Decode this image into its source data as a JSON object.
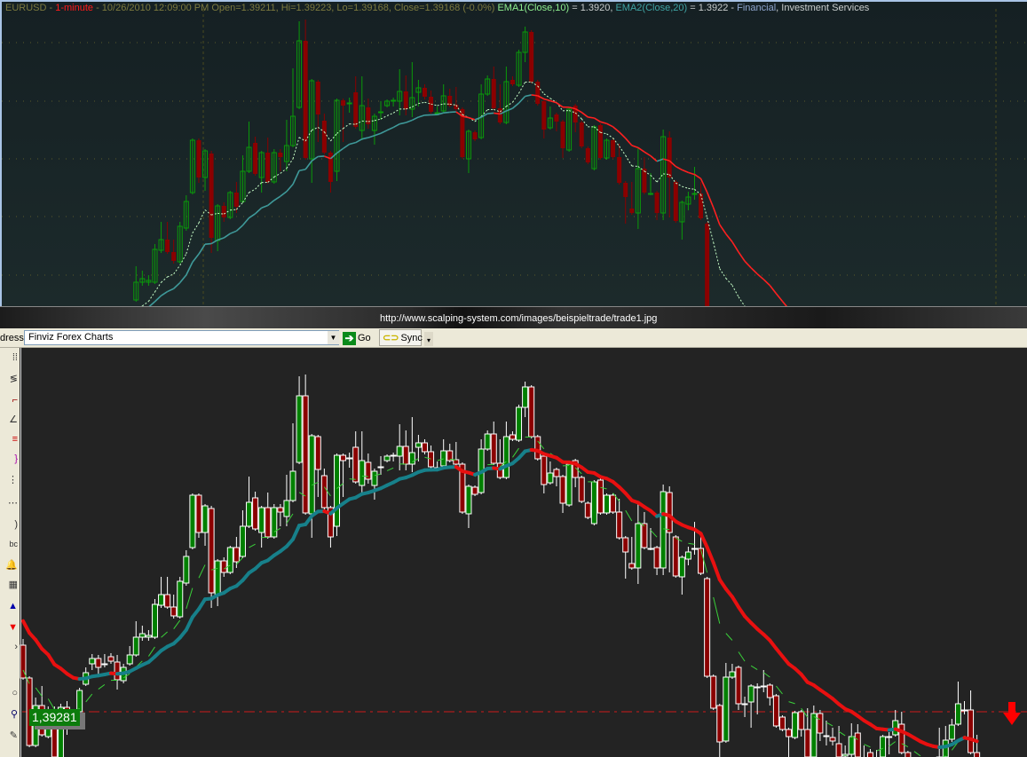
{
  "top_chart": {
    "symbol": "EURUSD",
    "sep1": " - ",
    "interval": "1-minute",
    "readout": " - 10/26/2010 12:09:00 PM Open=1.39211, Hi=1.39223, Lo=1.39168, Close=1.39168 (-0.0%) ",
    "ema1_label": "EMA1(Close,10)",
    "ema1_value": " = 1.3920, ",
    "ema2_label": "EMA2(Close,20)",
    "ema2_value": " = 1.3922 - ",
    "category_a": "Financial",
    "category_b": ", Investment Services"
  },
  "browser": {
    "url": "http://www.scalping-system.com/images/beispieltrade/trade1.jpg",
    "address_label": "dress",
    "address_value": "Finviz Forex Charts",
    "dropdown_icon": "▼",
    "go_label": "Go",
    "sync_label": "Sync",
    "more_icon": "▾"
  },
  "toolbar_icons": [
    "grid-dots",
    "trend-lines",
    "line-tool",
    "fan-tool",
    "color-lines",
    "bracket-tool",
    "vertical-dots",
    "horizontal-dots",
    "signal-tool",
    "text-abc",
    "bell-alert",
    "calculator",
    "buy-arrow",
    "sell-arrow",
    "pointer-tool",
    "circle-tool",
    "zoom-magnifier",
    "pencil-tool"
  ],
  "price_line": {
    "label": "1,39281",
    "value": 1.39281
  },
  "colors": {
    "up": "#008000",
    "down": "#8b0000",
    "ema_rise": "#17808a",
    "ema_fall": "#e81010",
    "ema10": "#3ad03a",
    "price_line": "#cc1a1a",
    "arrow": "#ff0000"
  },
  "chart_data": {
    "type": "candlestick",
    "title": "EURUSD - 1-minute",
    "xlabel": "",
    "ylabel": "",
    "indicators": [
      {
        "name": "EMA1(Close,10)",
        "period": 10,
        "seed": 1.3933
      },
      {
        "name": "EMA2(Close,20)",
        "period": 20,
        "seed": 1.3939
      }
    ],
    "ohlc_fields": [
      "open",
      "high",
      "low",
      "close"
    ],
    "candles": [
      [
        1.39356,
        1.39363,
        1.39317,
        1.39319
      ],
      [
        1.39319,
        1.39321,
        1.39241,
        1.39243
      ],
      [
        1.39243,
        1.39297,
        1.39241,
        1.39288
      ],
      [
        1.39288,
        1.3931,
        1.39253,
        1.39255
      ],
      [
        1.39253,
        1.39287,
        1.39251,
        1.39283
      ],
      [
        1.39283,
        1.39287,
        1.39221,
        1.3923
      ],
      [
        1.39223,
        1.3929,
        1.39221,
        1.39286
      ],
      [
        1.39286,
        1.39293,
        1.39255,
        1.39268
      ],
      [
        1.39278,
        1.39283,
        1.39271,
        1.39276
      ],
      [
        1.39281,
        1.39308,
        1.39278,
        1.39305
      ],
      [
        1.39312,
        1.39331,
        1.3931,
        1.39325
      ],
      [
        1.39335,
        1.39346,
        1.39328,
        1.39341
      ],
      [
        1.39341,
        1.39345,
        1.39323,
        1.39331
      ],
      [
        1.39335,
        1.39346,
        1.39331,
        1.39335
      ],
      [
        1.39343,
        1.39347,
        1.39335,
        1.39338
      ],
      [
        1.39337,
        1.39345,
        1.39306,
        1.39317
      ],
      [
        1.39316,
        1.39335,
        1.39313,
        1.39331
      ],
      [
        1.39335,
        1.39355,
        1.39333,
        1.39345
      ],
      [
        1.39345,
        1.39383,
        1.39343,
        1.39365
      ],
      [
        1.39365,
        1.39378,
        1.39361,
        1.39369
      ],
      [
        1.39365,
        1.39373,
        1.39361,
        1.39367
      ],
      [
        1.39365,
        1.39408,
        1.39363,
        1.39402
      ],
      [
        1.39401,
        1.39433,
        1.39398,
        1.39413
      ],
      [
        1.39413,
        1.39433,
        1.39397,
        1.39399
      ],
      [
        1.39399,
        1.39413,
        1.39386,
        1.39389
      ],
      [
        1.39388,
        1.39433,
        1.39386,
        1.39428
      ],
      [
        1.39426,
        1.39463,
        1.39423,
        1.39456
      ],
      [
        1.39466,
        1.39527,
        1.39464,
        1.39525
      ],
      [
        1.39525,
        1.39527,
        1.39477,
        1.39483
      ],
      [
        1.39483,
        1.39515,
        1.39468,
        1.39513
      ],
      [
        1.3951,
        1.39513,
        1.39398,
        1.39415
      ],
      [
        1.39412,
        1.39453,
        1.394,
        1.39451
      ],
      [
        1.39451,
        1.39455,
        1.39433,
        1.39438
      ],
      [
        1.39438,
        1.39468,
        1.39436,
        1.39466
      ],
      [
        1.39466,
        1.39478,
        1.39443,
        1.3945
      ],
      [
        1.39456,
        1.39508,
        1.39454,
        1.3949
      ],
      [
        1.3949,
        1.39546,
        1.39488,
        1.39517
      ],
      [
        1.39522,
        1.39529,
        1.39485,
        1.39487
      ],
      [
        1.39483,
        1.39513,
        1.39466,
        1.39511
      ],
      [
        1.39511,
        1.39528,
        1.39476,
        1.39478
      ],
      [
        1.39478,
        1.39515,
        1.39476,
        1.39511
      ],
      [
        1.39511,
        1.39515,
        1.3949,
        1.39506
      ],
      [
        1.39501,
        1.39548,
        1.3949,
        1.39519
      ],
      [
        1.39519,
        1.39606,
        1.39517,
        1.39552
      ],
      [
        1.39562,
        1.39659,
        1.3956,
        1.39637
      ],
      [
        1.39637,
        1.39661,
        1.39503,
        1.39505
      ],
      [
        1.39504,
        1.39594,
        1.39477,
        1.39592
      ],
      [
        1.39591,
        1.39593,
        1.39523,
        1.39554
      ],
      [
        1.39547,
        1.39555,
        1.39509,
        1.39511
      ],
      [
        1.39511,
        1.39513,
        1.39466,
        1.39478
      ],
      [
        1.3949,
        1.39572,
        1.39479,
        1.3957
      ],
      [
        1.3957,
        1.39572,
        1.39523,
        1.39564
      ],
      [
        1.39567,
        1.39573,
        1.39556,
        1.39567
      ],
      [
        1.39579,
        1.39597,
        1.39538,
        1.3954
      ],
      [
        1.39536,
        1.39597,
        1.39525,
        1.39564
      ],
      [
        1.39562,
        1.39572,
        1.39538,
        1.39543
      ],
      [
        1.39536,
        1.39555,
        1.3952,
        1.39552
      ],
      [
        1.39557,
        1.39569,
        1.39548,
        1.39557
      ],
      [
        1.39564,
        1.39571,
        1.39562,
        1.39569
      ],
      [
        1.3957,
        1.39573,
        1.39563,
        1.3957
      ],
      [
        1.39569,
        1.39605,
        1.39553,
        1.3958
      ],
      [
        1.3958,
        1.39598,
        1.39553,
        1.3956
      ],
      [
        1.3956,
        1.39613,
        1.39551,
        1.39573
      ],
      [
        1.39579,
        1.39593,
        1.39563,
        1.39584
      ],
      [
        1.39584,
        1.39588,
        1.39571,
        1.39574
      ],
      [
        1.39574,
        1.39581,
        1.39555,
        1.39557
      ],
      [
        1.39556,
        1.39563,
        1.39553,
        1.39556
      ],
      [
        1.39558,
        1.39588,
        1.39556,
        1.39575
      ],
      [
        1.39575,
        1.39583,
        1.39562,
        1.39564
      ],
      [
        1.39565,
        1.39585,
        1.39558,
        1.3956
      ],
      [
        1.3956,
        1.39562,
        1.39504,
        1.39506
      ],
      [
        1.39504,
        1.39537,
        1.39488,
        1.39535
      ],
      [
        1.39534,
        1.39536,
        1.39524,
        1.39526
      ],
      [
        1.39528,
        1.39588,
        1.39526,
        1.39577
      ],
      [
        1.39577,
        1.39598,
        1.39575,
        1.39594
      ],
      [
        1.39594,
        1.39608,
        1.39559,
        1.39561
      ],
      [
        1.39561,
        1.39588,
        1.39543,
        1.39545
      ],
      [
        1.39545,
        1.39608,
        1.39543,
        1.39591
      ],
      [
        1.39593,
        1.39597,
        1.39586,
        1.39588
      ],
      [
        1.39587,
        1.39627,
        1.39585,
        1.39624
      ],
      [
        1.39624,
        1.39653,
        1.39613,
        1.39647
      ],
      [
        1.39647,
        1.39649,
        1.39589,
        1.39591
      ],
      [
        1.39591,
        1.39593,
        1.39564,
        1.39566
      ],
      [
        1.39569,
        1.39571,
        1.39527,
        1.39537
      ],
      [
        1.39539,
        1.39563,
        1.39537,
        1.3955
      ],
      [
        1.39554,
        1.39556,
        1.39535,
        1.39546
      ],
      [
        1.39546,
        1.39548,
        1.39505,
        1.39516
      ],
      [
        1.39514,
        1.39562,
        1.39512,
        1.3956
      ],
      [
        1.39564,
        1.39566,
        1.39534,
        1.39545
      ],
      [
        1.39545,
        1.39547,
        1.39516,
        1.39518
      ],
      [
        1.39516,
        1.39518,
        1.39498,
        1.395
      ],
      [
        1.39493,
        1.39542,
        1.39491,
        1.3954
      ],
      [
        1.39542,
        1.39544,
        1.39503,
        1.39505
      ],
      [
        1.39505,
        1.39527,
        1.39503,
        1.39525
      ],
      [
        1.39525,
        1.39527,
        1.39504,
        1.39506
      ],
      [
        1.39506,
        1.39521,
        1.39475,
        1.39477
      ],
      [
        1.39477,
        1.39479,
        1.39431,
        1.39461
      ],
      [
        1.39448,
        1.39478,
        1.39441,
        1.39443
      ],
      [
        1.39443,
        1.39516,
        1.39425,
        1.39493
      ],
      [
        1.39493,
        1.39506,
        1.39464,
        1.39466
      ],
      [
        1.39465,
        1.39488,
        1.39463,
        1.39465
      ],
      [
        1.39466,
        1.39468,
        1.39435,
        1.39443
      ],
      [
        1.39443,
        1.39537,
        1.39435,
        1.39529
      ],
      [
        1.39528,
        1.39535,
        1.39438,
        1.39483
      ],
      [
        1.39478,
        1.3948,
        1.39432,
        1.39434
      ],
      [
        1.39433,
        1.39457,
        1.39413,
        1.39455
      ],
      [
        1.39453,
        1.39467,
        1.39446,
        1.39461
      ],
      [
        1.39465,
        1.39495,
        1.39458,
        1.39465
      ],
      [
        1.39465,
        1.39478,
        1.39435,
        1.39437
      ],
      [
        1.39431,
        1.39433,
        1.39319,
        1.39321
      ],
      [
        1.39321,
        1.39323,
        1.39283,
        1.39285
      ],
      [
        1.39288,
        1.3929,
        1.3923,
        1.39247
      ],
      [
        1.39248,
        1.39336,
        1.39246,
        1.3932
      ],
      [
        1.3932,
        1.39335,
        1.39318,
        1.39326
      ],
      [
        1.39331,
        1.39333,
        1.39283,
        1.3929
      ],
      [
        1.3929,
        1.39298,
        1.39275,
        1.3929
      ],
      [
        1.39292,
        1.39312,
        1.39263,
        1.3931
      ],
      [
        1.39309,
        1.39313,
        1.39278,
        1.39309
      ],
      [
        1.3931,
        1.39328,
        1.39303,
        1.3931
      ],
      [
        1.39311,
        1.39313,
        1.39288,
        1.39297
      ],
      [
        1.39299,
        1.39301,
        1.39263,
        1.39265
      ],
      [
        1.39275,
        1.39277,
        1.39259,
        1.39261
      ],
      [
        1.39261,
        1.39263,
        1.3923,
        1.39253
      ],
      [
        1.39252,
        1.39282,
        1.3925,
        1.3928
      ],
      [
        1.39281,
        1.39283,
        1.39253,
        1.39261
      ],
      [
        1.39261,
        1.39285,
        1.39223,
        1.3923
      ],
      [
        1.3923,
        1.39288,
        1.39223,
        1.39279
      ],
      [
        1.39279,
        1.39283,
        1.39248,
        1.39257
      ],
      [
        1.39254,
        1.39271,
        1.39243,
        1.39254
      ],
      [
        1.39252,
        1.39263,
        1.39243,
        1.39248
      ],
      [
        1.39245,
        1.39265,
        1.39223,
        1.3923
      ],
      [
        1.39231,
        1.39243,
        1.39225,
        1.39233
      ],
      [
        1.39233,
        1.39268,
        1.39228,
        1.39253
      ],
      [
        1.39257,
        1.39267,
        1.39223,
        1.3923
      ],
      [
        1.39228,
        1.39243,
        1.39213,
        1.39221
      ],
      [
        1.39235,
        1.39239,
        1.39221,
        1.39227
      ],
      [
        1.39225,
        1.39238,
        1.39213,
        1.39217
      ],
      [
        1.3923,
        1.39255,
        1.39225,
        1.39253
      ],
      [
        1.39253,
        1.39258,
        1.39233,
        1.39253
      ],
      [
        1.39255,
        1.39283,
        1.39253,
        1.39271
      ],
      [
        1.39267,
        1.39281,
        1.39233,
        1.39235
      ],
      [
        1.39235,
        1.39237,
        1.39217,
        1.39225
      ],
      [
        1.39225,
        1.39227,
        1.39208,
        1.39213
      ],
      [
        1.39213,
        1.39218,
        1.39198,
        1.39208
      ],
      [
        1.39208,
        1.39221,
        1.39203,
        1.39215
      ],
      [
        1.39215,
        1.39225,
        1.39211,
        1.39221
      ],
      [
        1.39221,
        1.39263,
        1.39218,
        1.3923
      ],
      [
        1.3923,
        1.39265,
        1.39227,
        1.39249
      ],
      [
        1.3925,
        1.39273,
        1.39247,
        1.39266
      ],
      [
        1.39267,
        1.39315,
        1.39265,
        1.3929
      ],
      [
        1.39283,
        1.39293,
        1.39278,
        1.39283
      ],
      [
        1.39283,
        1.39305,
        1.39233,
        1.39235
      ],
      [
        1.39235,
        1.39255,
        1.39215,
        1.39225
      ]
    ]
  }
}
